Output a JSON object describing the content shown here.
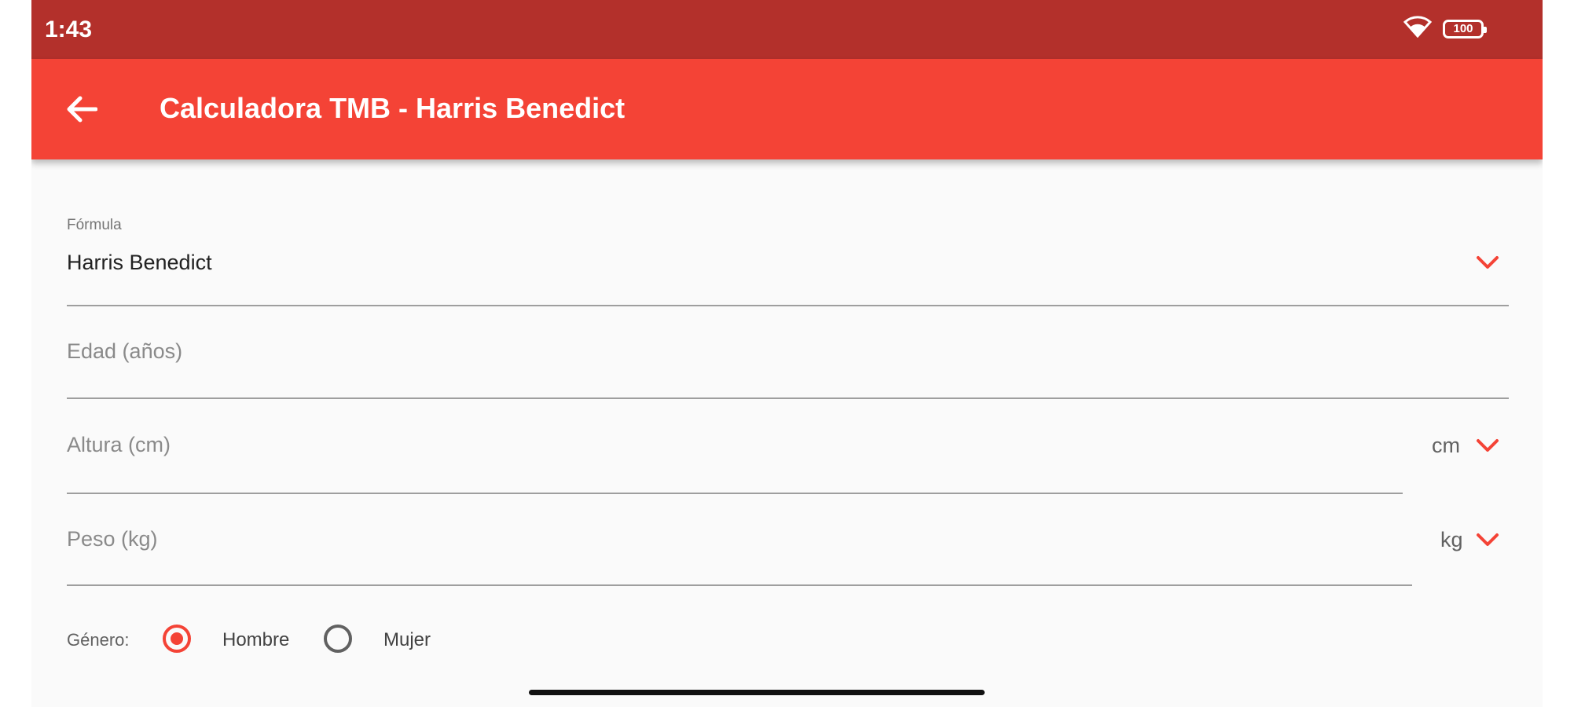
{
  "status_bar": {
    "time": "1:43",
    "battery": "100",
    "wifi_icon": "wifi-icon",
    "battery_icon": "battery-icon"
  },
  "app_bar": {
    "title": "Calculadora TMB - Harris Benedict",
    "back_icon": "arrow-back-icon",
    "background": "#f44336",
    "status_background": "#b3302b"
  },
  "form": {
    "formula": {
      "label": "Fórmula",
      "value": "Harris Benedict"
    },
    "age": {
      "placeholder": "Edad (años)"
    },
    "height": {
      "placeholder": "Altura (cm)",
      "unit": "cm"
    },
    "weight": {
      "placeholder": "Peso (kg)",
      "unit": "kg"
    },
    "gender": {
      "label": "Género:",
      "options": [
        "Hombre",
        "Mujer"
      ],
      "selected": "Hombre"
    },
    "accent_color": "#f44336"
  }
}
